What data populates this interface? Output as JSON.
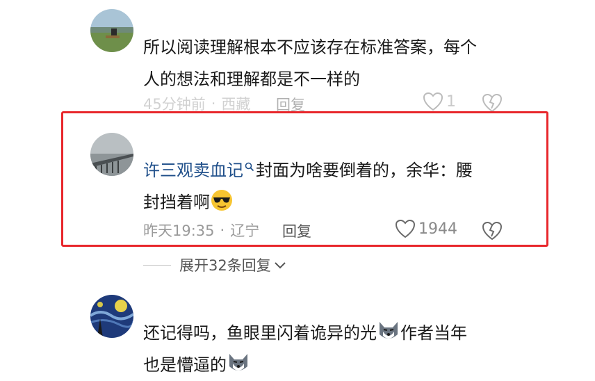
{
  "comments": [
    {
      "text_line1": "所以阅读理解根本不应该存在标准答案，每个",
      "text_line2": "人的想法和理解都是不一样的",
      "time": "45分钟前",
      "location": "西藏",
      "reply_label": "回复",
      "likes": "1"
    },
    {
      "topic_link": "许三观卖血记",
      "text_line1_rest": "封面为啥要倒着的，余华：腰",
      "text_line2": "封挡着啊",
      "emoji": "sunglasses-face",
      "time": "昨天19:35",
      "location": "辽宁",
      "reply_label": "回复",
      "likes": "1944"
    },
    {
      "text_line1": "还记得吗，鱼眼里闪着诡异的光",
      "text_line1_after": "作者当年",
      "text_line2": "也是懵逼的",
      "emoji": "wolf-face"
    }
  ],
  "expand_replies_label": "展开32条回复",
  "highlight_color": "#e8262b",
  "link_color": "#1f4f8a"
}
